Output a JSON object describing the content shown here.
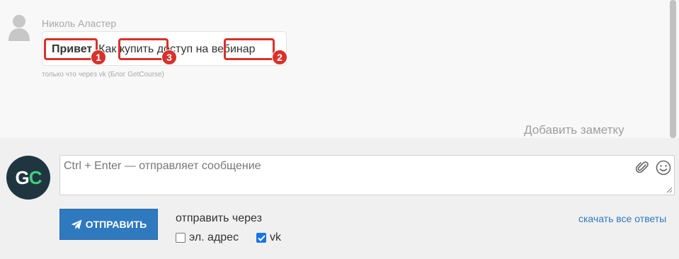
{
  "message": {
    "author": "Николь Аластер",
    "greeting": "Привет",
    "text_rest": ". Как купить доступ на вебинар",
    "meta": "только что через vk (Блог GetCourse)"
  },
  "annotations": [
    "1",
    "2",
    "3"
  ],
  "add_note": "Добавить заметку",
  "reply": {
    "placeholder": "Ctrl + Enter — отправляет сообщение",
    "send_label": "ОТПРАВИТЬ",
    "send_via_label": "отправить через",
    "channels": [
      {
        "label": "эл. адрес",
        "checked": false
      },
      {
        "label": "vk",
        "checked": true
      }
    ],
    "download_label": "скачать все ответы"
  },
  "logo": {
    "g": "G",
    "c": "C"
  },
  "colors": {
    "accent": "#2f79bf",
    "highlight": "#d8322a",
    "logo_bg": "#1f3640",
    "logo_green": "#3fd07a"
  }
}
